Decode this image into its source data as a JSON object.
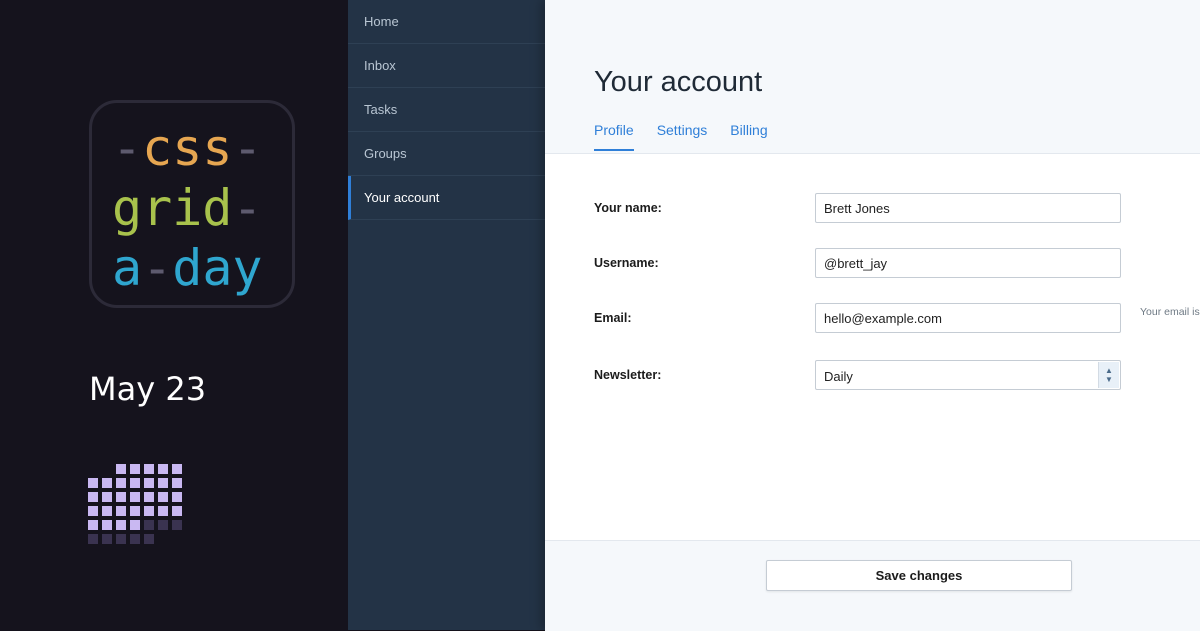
{
  "brand": {
    "logo": {
      "line1": {
        "pre": "-",
        "word": "css",
        "post": "-"
      },
      "line2": {
        "pre": "",
        "word": "grid",
        "post": "-"
      },
      "line3": {
        "pre": "",
        "word": "a",
        "mid": "-",
        "word2": "day"
      }
    },
    "date": "May 23",
    "colors": {
      "css": "#e6a651",
      "grid": "#a8c24c",
      "day": "#2fa6cf",
      "pixel": "#c9b8f2"
    }
  },
  "nav": {
    "items": [
      {
        "label": "Home"
      },
      {
        "label": "Inbox"
      },
      {
        "label": "Tasks"
      },
      {
        "label": "Groups"
      },
      {
        "label": "Your account",
        "active": true
      }
    ]
  },
  "main": {
    "title": "Your account",
    "tabs": [
      {
        "label": "Profile",
        "active": true
      },
      {
        "label": "Settings"
      },
      {
        "label": "Billing"
      }
    ],
    "form": {
      "name": {
        "label": "Your name:",
        "value": "Brett Jones"
      },
      "username": {
        "label": "Username:",
        "value": "@brett_jay"
      },
      "email": {
        "label": "Email:",
        "value": "hello@example.com",
        "help": "Your email is used to s notifications will be d"
      },
      "newsletter": {
        "label": "Newsletter:",
        "value": "Daily"
      }
    },
    "save_label": "Save changes"
  }
}
